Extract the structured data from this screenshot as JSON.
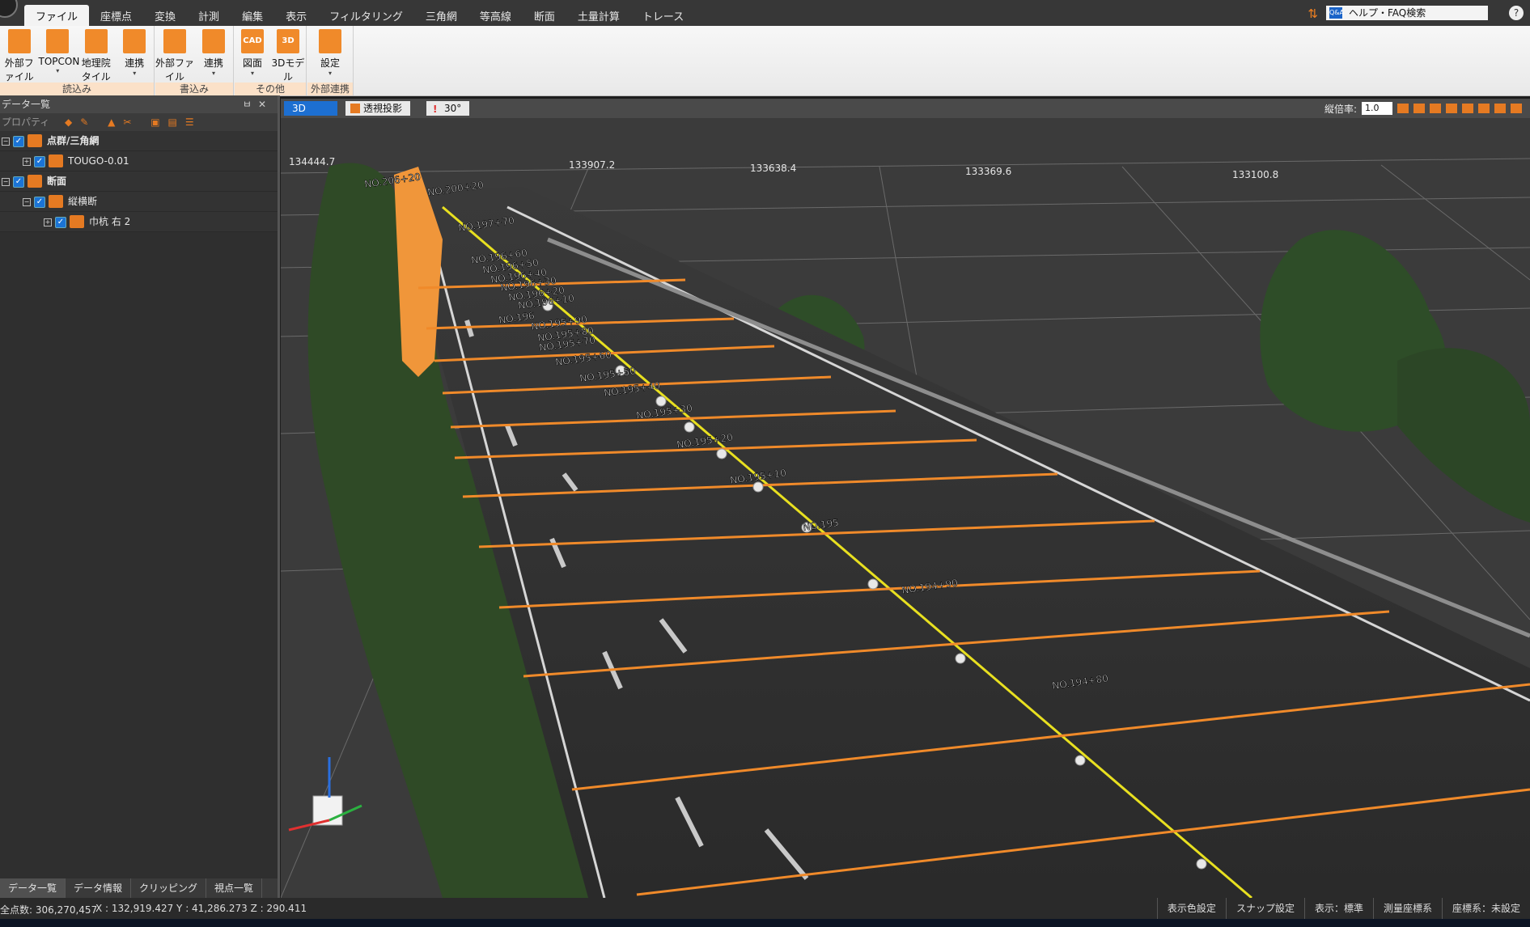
{
  "menu": {
    "tabs": [
      "ファイル",
      "座標点",
      "変換",
      "計測",
      "編集",
      "表示",
      "フィルタリング",
      "三角網",
      "等高線",
      "断面",
      "土量計算",
      "トレース"
    ],
    "active_index": 0,
    "help_label": "ヘルプ・FAQ検索",
    "help_icon_text": "Q&A"
  },
  "ribbon": {
    "groups": [
      {
        "caption": "読込み",
        "buttons": [
          {
            "label": "外部ファイル",
            "icon": "orange-file-icon"
          },
          {
            "label": "TOPCON",
            "icon": "instrument-icon"
          },
          {
            "label": "地理院タイル",
            "icon": "map-tile-icon"
          },
          {
            "label": "連携",
            "icon": "link-icon"
          }
        ]
      },
      {
        "caption": "書込み",
        "buttons": [
          {
            "label": "外部ファイル",
            "icon": "orange-file-export-icon"
          },
          {
            "label": "連携",
            "icon": "link-export-icon"
          }
        ]
      },
      {
        "caption": "その他",
        "buttons": [
          {
            "label": "図面",
            "icon": "cad-icon",
            "icon_text": "CAD"
          },
          {
            "label": "3Dモデル",
            "icon": "3d-model-icon",
            "icon_text": "3D"
          }
        ]
      },
      {
        "caption": "外部連携",
        "buttons": [
          {
            "label": "設定",
            "icon": "gear-icon"
          }
        ]
      }
    ]
  },
  "left_panel": {
    "title": "データ一覧",
    "toolbar_label": "プロパティ",
    "tree": [
      {
        "label": "点群/三角網",
        "level": 0
      },
      {
        "label": "TOUGO-0.01",
        "level": 1
      },
      {
        "label": "断面",
        "level": 0
      },
      {
        "label": "縦横断",
        "level": 1
      },
      {
        "label": "巾杭 右 2",
        "level": 2
      }
    ],
    "bottom_tabs": [
      "データ一覧",
      "データ情報",
      "クリッピング",
      "視点一覧"
    ]
  },
  "viewport": {
    "tabs": [
      "3D",
      "透視投影",
      "30°"
    ],
    "scale_label": "縦倍率:",
    "scale_value": "1.0",
    "grid_labels": [
      "134444.7",
      "133907.2",
      "133638.4",
      "133369.6",
      "133100.8"
    ],
    "stations": [
      "NO.206+20",
      "NO.200+20",
      "NO.197+70",
      "NO.196+60",
      "NO.196+50",
      "NO.196+40",
      "NO.196+30",
      "NO.196+20",
      "NO.196+10",
      "NO.196",
      "NO.195+90",
      "NO.195+80",
      "NO.195+70",
      "NO.195+60",
      "NO.195+50",
      "NO.195+40",
      "NO.195+30",
      "NO.195+20",
      "NO.195+10",
      "NO.195",
      "NO.194+90",
      "NO.194+80"
    ]
  },
  "status": {
    "points": "全点数: 306,270,457",
    "coords": "X : 132,919.427  Y : 41,286.273  Z : 290.411",
    "right_items": [
      "表示色設定",
      "スナップ設定",
      "表示：標準",
      "測量座標系",
      "座標系：未設定"
    ]
  },
  "colors": {
    "accent": "#f08a2a",
    "centerline": "#e8e020",
    "ribbon_caption": "#fbe1c8"
  }
}
